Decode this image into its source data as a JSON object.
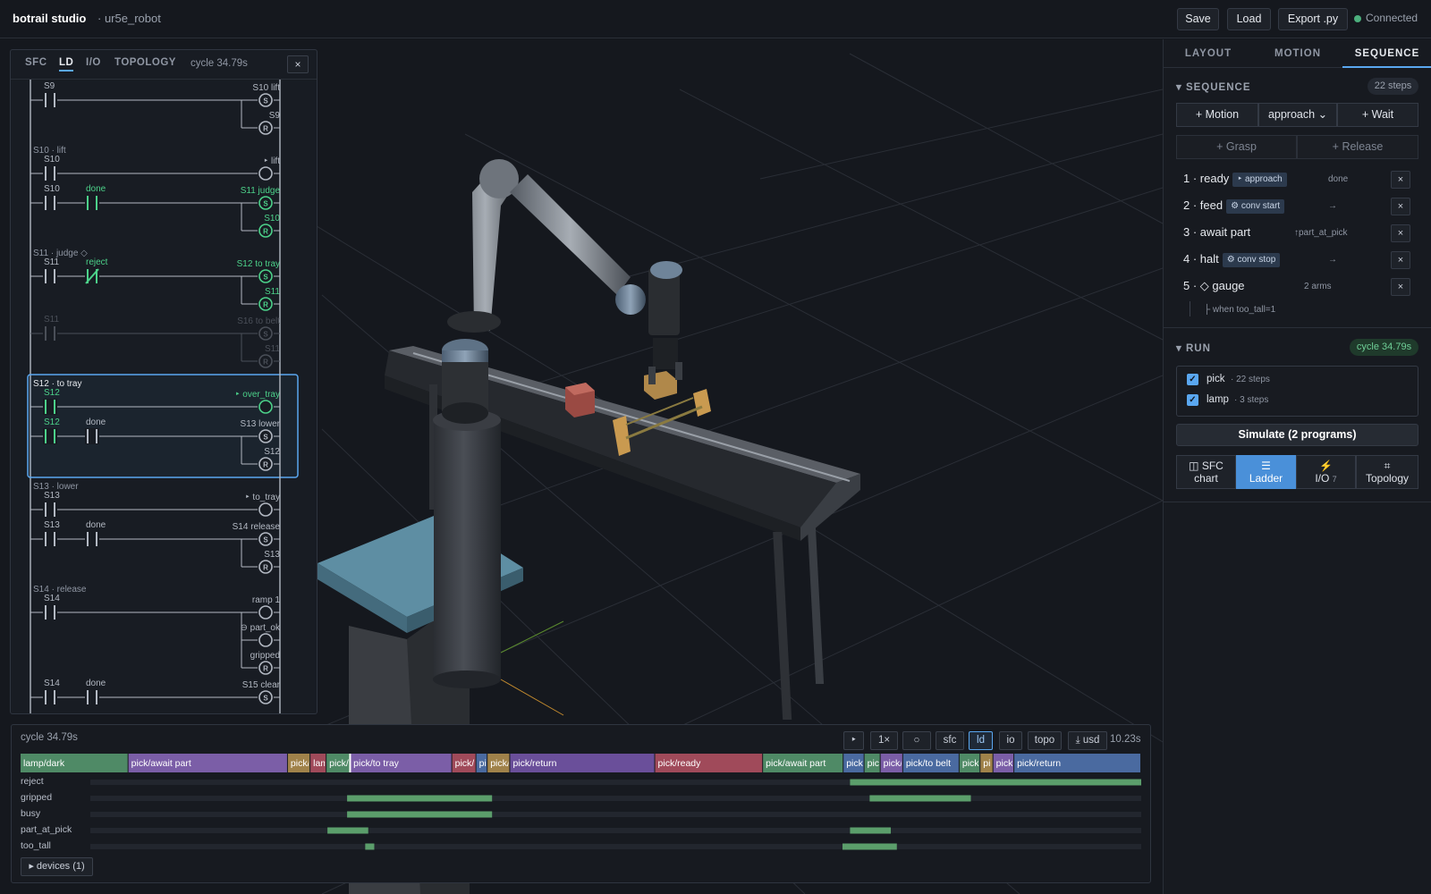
{
  "app": {
    "title": "botrail studio",
    "project": "· ur5e_robot"
  },
  "toolbar": {
    "save": "Save",
    "load": "Load",
    "export": "Export .py",
    "status": "Connected",
    "status_color": "#4caf7d"
  },
  "ladder": {
    "tabs": [
      "SFC",
      "LD",
      "I/O",
      "TOPOLOGY"
    ],
    "active_tab": "LD",
    "cycle": "cycle 34.79s",
    "close": "×",
    "rungs": [
      {
        "title": "",
        "rows": [
          {
            "contacts": [
              {
                "label": "S9",
                "type": "no"
              }
            ],
            "coil": {
              "label": "S10 lift",
              "type": "S"
            }
          },
          {
            "contacts": [],
            "coil": {
              "label": "S9",
              "type": "R"
            }
          }
        ]
      },
      {
        "title": "S10 · lift",
        "rows": [
          {
            "contacts": [
              {
                "label": "S10",
                "type": "no"
              }
            ],
            "coil": {
              "label": "‣ lift",
              "type": "out"
            }
          }
        ]
      },
      {
        "title": "",
        "rows": [
          {
            "contacts": [
              {
                "label": "S10",
                "type": "no"
              },
              {
                "label": "done",
                "type": "no",
                "active": true
              }
            ],
            "coil": {
              "label": "S11 judge",
              "type": "S",
              "active": true
            }
          },
          {
            "contacts": [],
            "coil": {
              "label": "S10",
              "type": "R",
              "active": true
            }
          }
        ]
      },
      {
        "title": "S11 · judge ◇",
        "rows": [
          {
            "contacts": [
              {
                "label": "S11",
                "type": "no"
              },
              {
                "label": "reject",
                "type": "nc",
                "active": true
              }
            ],
            "coil": {
              "label": "S12 to tray",
              "type": "S",
              "active": true
            }
          },
          {
            "contacts": [],
            "coil": {
              "label": "S11",
              "type": "R",
              "active": true
            }
          }
        ]
      },
      {
        "title": "",
        "dim": true,
        "rows": [
          {
            "contacts": [
              {
                "label": "S11",
                "type": "no"
              }
            ],
            "coil": {
              "label": "S16 to belt",
              "type": "S"
            }
          },
          {
            "contacts": [],
            "coil": {
              "label": "S11",
              "type": "R"
            }
          }
        ]
      },
      {
        "title": "S12 · to tray",
        "highlight": true,
        "rows": [
          {
            "contacts": [
              {
                "label": "S12",
                "type": "no",
                "active": true
              }
            ],
            "coil": {
              "label": "‣ over_tray",
              "type": "out",
              "active": true
            }
          }
        ]
      },
      {
        "title": "",
        "highlight": true,
        "rows": [
          {
            "contacts": [
              {
                "label": "S12",
                "type": "no",
                "active": true
              },
              {
                "label": "done",
                "type": "no"
              }
            ],
            "coil": {
              "label": "S13 lower",
              "type": "S"
            }
          },
          {
            "contacts": [],
            "coil": {
              "label": "S12",
              "type": "R"
            }
          }
        ]
      },
      {
        "title": "S13 · lower",
        "rows": [
          {
            "contacts": [
              {
                "label": "S13",
                "type": "no"
              }
            ],
            "coil": {
              "label": "‣ to_tray",
              "type": "out"
            }
          }
        ]
      },
      {
        "title": "",
        "rows": [
          {
            "contacts": [
              {
                "label": "S13",
                "type": "no"
              },
              {
                "label": "done",
                "type": "no"
              }
            ],
            "coil": {
              "label": "S14 release",
              "type": "S"
            }
          },
          {
            "contacts": [],
            "coil": {
              "label": "S13",
              "type": "R"
            }
          }
        ]
      },
      {
        "title": "S14 · release",
        "rows": [
          {
            "contacts": [
              {
                "label": "S14",
                "type": "no"
              }
            ],
            "coil": {
              "label": "ramp 1",
              "type": "out"
            }
          },
          {
            "contacts": [],
            "coil": {
              "label": "⊖ part_ok",
              "type": "out"
            }
          },
          {
            "contacts": [],
            "coil": {
              "label": "gripped",
              "type": "R"
            }
          }
        ]
      },
      {
        "title": "",
        "rows": [
          {
            "contacts": [
              {
                "label": "S14",
                "type": "no"
              },
              {
                "label": "done",
                "type": "no"
              }
            ],
            "coil": {
              "label": "S15 clear",
              "type": "S"
            }
          }
        ]
      }
    ]
  },
  "right": {
    "tabs": [
      "LAYOUT",
      "MOTION",
      "SEQUENCE"
    ],
    "active_tab": "SEQUENCE",
    "sequence": {
      "title": "SEQUENCE",
      "count": "22 steps",
      "add_motion": "+ Motion",
      "motion_select": "approach",
      "add_wait": "+ Wait",
      "add_grasp": "+ Grasp",
      "add_release": "+ Release",
      "steps": [
        {
          "label": "1 · ready",
          "tag": "‣ approach",
          "info": "done"
        },
        {
          "label": "2 · feed",
          "tag": "⚙ conv start",
          "info": "→"
        },
        {
          "label": "3 · await part",
          "tag": "",
          "info": "↑part_at_pick"
        },
        {
          "label": "4 · halt",
          "tag": "⚙ conv stop",
          "info": "→"
        },
        {
          "label": "5 · ◇ gauge",
          "tag": "",
          "info": "2 arms"
        }
      ],
      "branch": "├ when too_tall=1",
      "remove": "×"
    },
    "run": {
      "title": "RUN",
      "cycle": "cycle 34.79s",
      "programs": [
        {
          "name": "pick",
          "steps": "· 22 steps",
          "checked": true
        },
        {
          "name": "lamp",
          "steps": "· 3 steps",
          "checked": true
        }
      ],
      "simulate": "Simulate (2 programs)",
      "views": [
        {
          "icon": "◫",
          "label": "SFC",
          "sub": "chart"
        },
        {
          "icon": "☰",
          "label": "Ladder",
          "sub": ""
        },
        {
          "icon": "⚡",
          "label": "I/O",
          "sub": "7"
        },
        {
          "icon": "⌗",
          "label": "Topology",
          "sub": ""
        }
      ],
      "active_view": "Ladder"
    }
  },
  "timeline": {
    "cycle": "cycle 34.79s",
    "controls": [
      "‣",
      "1×",
      "○",
      "sfc",
      "ld",
      "io",
      "topo",
      "⤓ usd"
    ],
    "active_control": "ld",
    "time": "10.23s",
    "duration": 34.79,
    "playhead": 10.23,
    "segments": [
      {
        "label": "lamp/dark",
        "start": 0,
        "end": 3.35,
        "color": "#4f8a66"
      },
      {
        "label": "pick/await part",
        "start": 3.35,
        "end": 8.3,
        "color": "#7b5ea7"
      },
      {
        "label": "pick/",
        "start": 8.3,
        "end": 9.0,
        "color": "#a0824a"
      },
      {
        "label": "lam",
        "start": 9.0,
        "end": 9.5,
        "color": "#a04a5a"
      },
      {
        "label": "pick/",
        "start": 9.5,
        "end": 10.25,
        "color": "#4f8a66"
      },
      {
        "label": "pick/to tray",
        "start": 10.25,
        "end": 13.4,
        "color": "#7b5ea7"
      },
      {
        "label": "pick/",
        "start": 13.4,
        "end": 14.15,
        "color": "#a04a5a"
      },
      {
        "label": "pi",
        "start": 14.15,
        "end": 14.5,
        "color": "#4a6aa0"
      },
      {
        "label": "pick/",
        "start": 14.5,
        "end": 15.2,
        "color": "#a0824a"
      },
      {
        "label": "pick/return",
        "start": 15.2,
        "end": 19.7,
        "color": "#6a4f9a"
      },
      {
        "label": "pick/ready",
        "start": 19.7,
        "end": 23.05,
        "color": "#a04a5a"
      },
      {
        "label": "pick/await part",
        "start": 23.05,
        "end": 25.55,
        "color": "#4f8a66"
      },
      {
        "label": "pick/",
        "start": 25.55,
        "end": 26.2,
        "color": "#4a6aa0"
      },
      {
        "label": "pic",
        "start": 26.2,
        "end": 26.7,
        "color": "#4f8a66"
      },
      {
        "label": "pick/",
        "start": 26.7,
        "end": 27.4,
        "color": "#7b5ea7"
      },
      {
        "label": "pick/to belt",
        "start": 27.4,
        "end": 29.15,
        "color": "#4a6aa0"
      },
      {
        "label": "pick",
        "start": 29.15,
        "end": 29.8,
        "color": "#4f8a66"
      },
      {
        "label": "pi",
        "start": 29.8,
        "end": 30.2,
        "color": "#a0824a"
      },
      {
        "label": "pick",
        "start": 30.2,
        "end": 30.85,
        "color": "#7b5ea7"
      },
      {
        "label": "pick/return",
        "start": 30.85,
        "end": 34.79,
        "color": "#4a6aa0"
      }
    ],
    "signals": [
      {
        "name": "reject",
        "pulses": [
          [
            25.15,
            34.79
          ]
        ]
      },
      {
        "name": "gripped",
        "pulses": [
          [
            8.5,
            13.3
          ],
          [
            25.8,
            29.15
          ]
        ]
      },
      {
        "name": "busy",
        "pulses": [
          [
            8.5,
            13.3
          ]
        ]
      },
      {
        "name": "part_at_pick",
        "pulses": [
          [
            7.85,
            9.2
          ],
          [
            25.15,
            26.5
          ]
        ]
      },
      {
        "name": "too_tall",
        "pulses": [
          [
            9.1,
            9.4
          ],
          [
            24.9,
            26.7
          ]
        ]
      }
    ],
    "signal_color": "#5b9e6b",
    "devices": "▸ devices (1)"
  }
}
